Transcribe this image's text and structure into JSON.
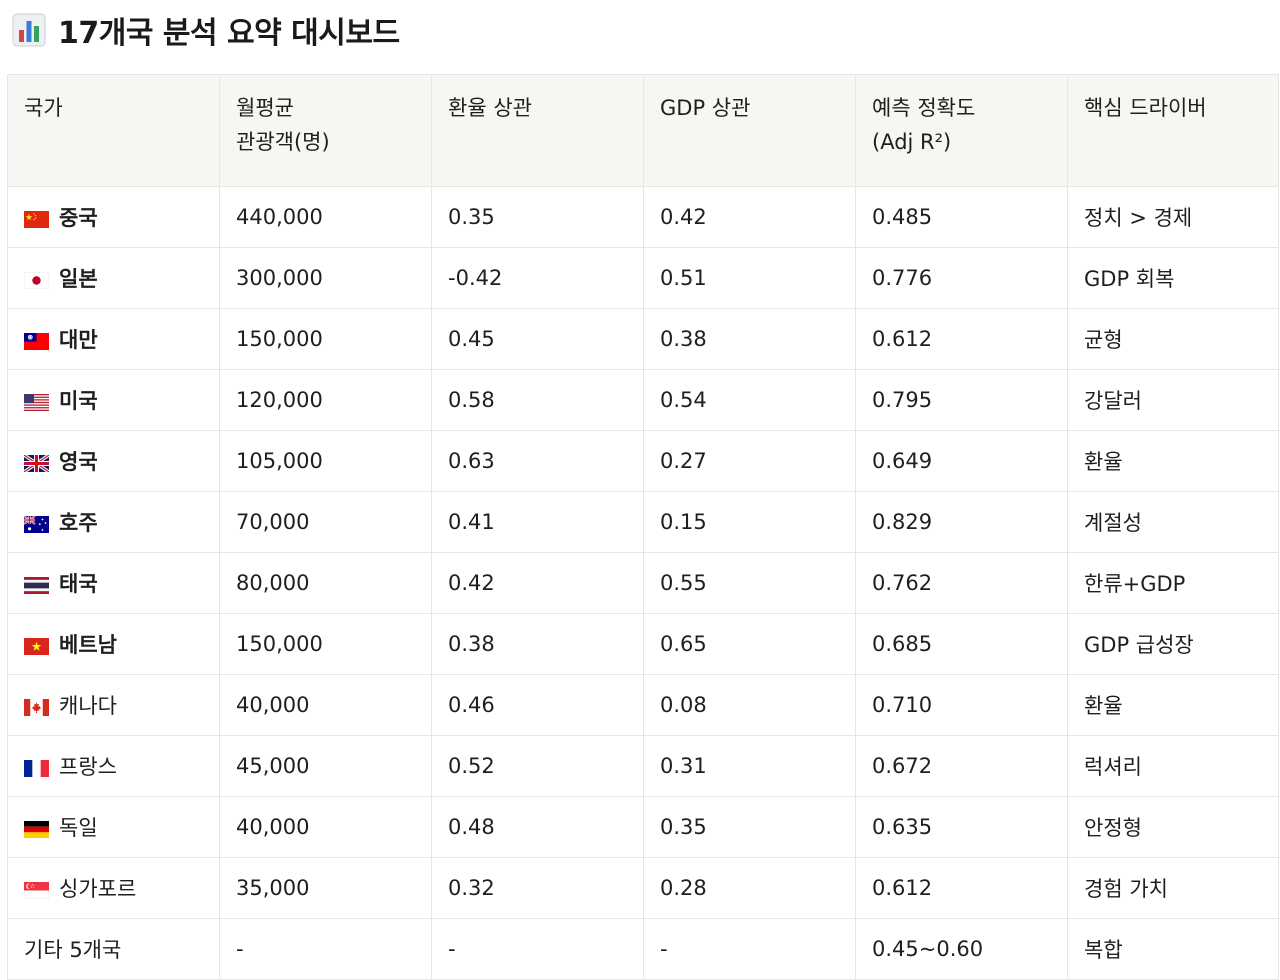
{
  "page": {
    "title": "17개국 분석 요약 대시보드",
    "title_icon": "bar-chart-icon"
  },
  "table": {
    "headers": [
      {
        "line1": "국가",
        "line2": ""
      },
      {
        "line1": "월평균",
        "line2": "관광객(명)"
      },
      {
        "line1": "환율 상관",
        "line2": ""
      },
      {
        "line1": "GDP 상관",
        "line2": ""
      },
      {
        "line1": "예측 정확도",
        "line2": "(Adj R²)"
      },
      {
        "line1": "핵심 드라이버",
        "line2": ""
      }
    ],
    "rows": [
      {
        "flag": "china-flag-icon",
        "country": "중국",
        "emphasis": true,
        "visitors": "440,000",
        "fx_corr": "0.35",
        "gdp_corr": "0.42",
        "adj_r2": "0.485",
        "driver": "정치 > 경제"
      },
      {
        "flag": "japan-flag-icon",
        "country": "일본",
        "emphasis": true,
        "visitors": "300,000",
        "fx_corr": "-0.42",
        "gdp_corr": "0.51",
        "adj_r2": "0.776",
        "driver": "GDP 회복"
      },
      {
        "flag": "taiwan-flag-icon",
        "country": "대만",
        "emphasis": true,
        "visitors": "150,000",
        "fx_corr": "0.45",
        "gdp_corr": "0.38",
        "adj_r2": "0.612",
        "driver": "균형"
      },
      {
        "flag": "usa-flag-icon",
        "country": "미국",
        "emphasis": true,
        "visitors": "120,000",
        "fx_corr": "0.58",
        "gdp_corr": "0.54",
        "adj_r2": "0.795",
        "driver": "강달러"
      },
      {
        "flag": "uk-flag-icon",
        "country": "영국",
        "emphasis": true,
        "visitors": "105,000",
        "fx_corr": "0.63",
        "gdp_corr": "0.27",
        "adj_r2": "0.649",
        "driver": "환율"
      },
      {
        "flag": "australia-flag-icon",
        "country": "호주",
        "emphasis": true,
        "visitors": "70,000",
        "fx_corr": "0.41",
        "gdp_corr": "0.15",
        "adj_r2": "0.829",
        "driver": "계절성"
      },
      {
        "flag": "thailand-flag-icon",
        "country": "태국",
        "emphasis": true,
        "visitors": "80,000",
        "fx_corr": "0.42",
        "gdp_corr": "0.55",
        "adj_r2": "0.762",
        "driver": "한류+GDP"
      },
      {
        "flag": "vietnam-flag-icon",
        "country": "베트남",
        "emphasis": true,
        "visitors": "150,000",
        "fx_corr": "0.38",
        "gdp_corr": "0.65",
        "adj_r2": "0.685",
        "driver": "GDP 급성장"
      },
      {
        "flag": "canada-flag-icon",
        "country": "캐나다",
        "emphasis": false,
        "visitors": "40,000",
        "fx_corr": "0.46",
        "gdp_corr": "0.08",
        "adj_r2": "0.710",
        "driver": "환율"
      },
      {
        "flag": "france-flag-icon",
        "country": "프랑스",
        "emphasis": false,
        "visitors": "45,000",
        "fx_corr": "0.52",
        "gdp_corr": "0.31",
        "adj_r2": "0.672",
        "driver": "럭셔리"
      },
      {
        "flag": "germany-flag-icon",
        "country": "독일",
        "emphasis": false,
        "visitors": "40,000",
        "fx_corr": "0.48",
        "gdp_corr": "0.35",
        "adj_r2": "0.635",
        "driver": "안정형"
      },
      {
        "flag": "singapore-flag-icon",
        "country": "싱가포르",
        "emphasis": false,
        "visitors": "35,000",
        "fx_corr": "0.32",
        "gdp_corr": "0.28",
        "adj_r2": "0.612",
        "driver": "경험 가치"
      },
      {
        "flag": "",
        "country": "기타 5개국",
        "emphasis": false,
        "visitors": "-",
        "fx_corr": "-",
        "gdp_corr": "-",
        "adj_r2": "0.45~0.60",
        "driver": "복합"
      }
    ]
  }
}
